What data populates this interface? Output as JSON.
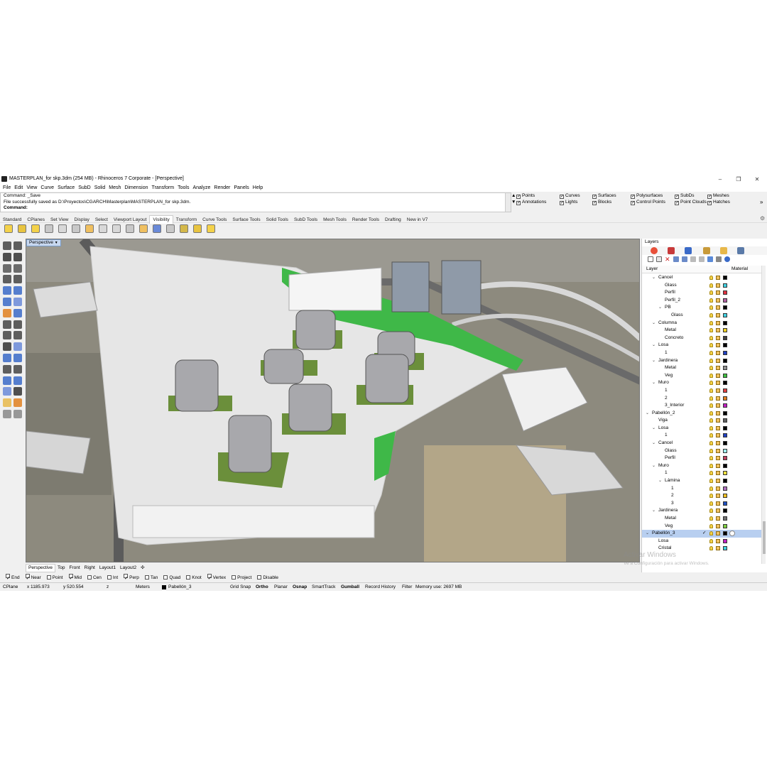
{
  "window": {
    "title": "MASTERPLAN_for skp.3dm (254 MB) - Rhinoceros 7 Corporate - [Perspective]",
    "minimize": "–",
    "maximize": "❐",
    "close": "✕"
  },
  "menu": [
    "File",
    "Edit",
    "View",
    "Curve",
    "Surface",
    "SubD",
    "Solid",
    "Mesh",
    "Dimension",
    "Transform",
    "Tools",
    "Analyze",
    "Render",
    "Panels",
    "Help"
  ],
  "command": {
    "line1": "Command: _Save",
    "line2": "File successfully saved as D:\\Proyectos\\CGARCH\\Masterplan\\MASTERPLAN_for skp.3dm.",
    "prompt": "Command:",
    "scroll_up": "▲",
    "scroll_down": "▼"
  },
  "selection_filters": [
    {
      "label": "Points",
      "checked": true
    },
    {
      "label": "Annotations",
      "checked": true
    },
    {
      "label": "Curves",
      "checked": true
    },
    {
      "label": "Lights",
      "checked": true
    },
    {
      "label": "Surfaces",
      "checked": true
    },
    {
      "label": "Blocks",
      "checked": true
    },
    {
      "label": "Polysurfaces",
      "checked": true
    },
    {
      "label": "Control Points",
      "checked": true
    },
    {
      "label": "SubDs",
      "checked": true
    },
    {
      "label": "Point Clouds",
      "checked": true
    },
    {
      "label": "Meshes",
      "checked": true
    },
    {
      "label": "Hatches",
      "checked": true
    }
  ],
  "filters_more": "»",
  "toolbar_tabs": [
    "Standard",
    "CPlanes",
    "Set View",
    "Display",
    "Select",
    "Viewport Layout",
    "Visibility",
    "Transform",
    "Curve Tools",
    "Surface Tools",
    "Solid Tools",
    "SubD Tools",
    "Mesh Tools",
    "Render Tools",
    "Drafting",
    "New in V7"
  ],
  "toolbar_active_tab": "Visibility",
  "toolbar_icons": [
    "show-icon",
    "hide-icon",
    "show-selected-icon",
    "swap-hidden-icon",
    "hide-swap-icon",
    "lock-icon",
    "unlock-icon",
    "lock-selected-icon",
    "unlock-selected-icon",
    "lock-swap-icon",
    "lock-icon",
    "isolate-icon",
    "unisolate-icon",
    "show-objects-icon",
    "hide-objects-icon",
    "show-layer-icon"
  ],
  "viewport": {
    "label": "Perspective",
    "dropdown": "▼",
    "tabs": [
      "Perspective",
      "Top",
      "Front",
      "Right",
      "Layout1",
      "Layout2"
    ],
    "add_tab": "✣",
    "active_tab": "Perspective"
  },
  "osnaps": [
    {
      "label": "End",
      "checked": true
    },
    {
      "label": "Near",
      "checked": true
    },
    {
      "label": "Point",
      "checked": false
    },
    {
      "label": "Mid",
      "checked": true
    },
    {
      "label": "Cen",
      "checked": false
    },
    {
      "label": "Int",
      "checked": false
    },
    {
      "label": "Perp",
      "checked": true
    },
    {
      "label": "Tan",
      "checked": false
    },
    {
      "label": "Quad",
      "checked": false
    },
    {
      "label": "Knot",
      "checked": false
    },
    {
      "label": "Vertex",
      "checked": true
    },
    {
      "label": "Project",
      "checked": false
    },
    {
      "label": "Disable",
      "checked": false
    }
  ],
  "status": {
    "cplane": "CPlane",
    "x": "x 1185.973",
    "y": "y 520.554",
    "z": "z",
    "units": "Meters",
    "layer": "Pabellón_3",
    "grid_snap": "Grid Snap",
    "ortho": "Ortho",
    "planar": "Planar",
    "osnap": "Osnap",
    "smarttrack": "SmartTrack",
    "gumball": "Gumball",
    "record_history": "Record History",
    "filter": "Filter",
    "memory": "Memory use: 2697 MB"
  },
  "layers_panel": {
    "title": "Layers",
    "col_layer": "Layer",
    "col_material": "Material",
    "rows": [
      {
        "name": "Cancel",
        "level": 1,
        "twisty": "v",
        "color": "#000000"
      },
      {
        "name": "Glass",
        "level": 2,
        "twisty": "",
        "color": "#40d0e0"
      },
      {
        "name": "Perfil",
        "level": 2,
        "twisty": "",
        "color": "#e03040"
      },
      {
        "name": "Perfil_2",
        "level": 2,
        "twisty": "",
        "color": "#b060a0"
      },
      {
        "name": "PB",
        "level": 2,
        "twisty": "v",
        "color": "#000000"
      },
      {
        "name": "Glass",
        "level": 3,
        "twisty": "",
        "color": "#40d0e0"
      },
      {
        "name": "Columna",
        "level": 1,
        "twisty": "v",
        "color": "#000000"
      },
      {
        "name": "Metal",
        "level": 2,
        "twisty": "",
        "color": "#f0d020"
      },
      {
        "name": "Concreto",
        "level": 2,
        "twisty": "",
        "color": "#404040"
      },
      {
        "name": "Losa",
        "level": 1,
        "twisty": "v",
        "color": "#000000"
      },
      {
        "name": "1",
        "level": 2,
        "twisty": "",
        "color": "#2040c0"
      },
      {
        "name": "Jardinera",
        "level": 1,
        "twisty": "v",
        "color": "#000000"
      },
      {
        "name": "Metal",
        "level": 2,
        "twisty": "",
        "color": "#909090"
      },
      {
        "name": "Veg",
        "level": 2,
        "twisty": "",
        "color": "#40c040"
      },
      {
        "name": "Muro",
        "level": 1,
        "twisty": "v",
        "color": "#000000"
      },
      {
        "name": "1",
        "level": 2,
        "twisty": "",
        "color": "#e04040"
      },
      {
        "name": "2",
        "level": 2,
        "twisty": "",
        "color": "#e08020"
      },
      {
        "name": "3_Interior",
        "level": 2,
        "twisty": "",
        "color": "#c020c0"
      },
      {
        "name": "Pabellón_2",
        "level": 0,
        "twisty": "v",
        "color": "#000000"
      },
      {
        "name": "Viga",
        "level": 1,
        "twisty": "",
        "color": "#606060"
      },
      {
        "name": "Losa",
        "level": 1,
        "twisty": "v",
        "color": "#000000"
      },
      {
        "name": "1",
        "level": 2,
        "twisty": "",
        "color": "#2040c0"
      },
      {
        "name": "Cancel",
        "level": 1,
        "twisty": "v",
        "color": "#000000"
      },
      {
        "name": "Glass",
        "level": 2,
        "twisty": "",
        "color": "#a0f0f0"
      },
      {
        "name": "Perfil",
        "level": 2,
        "twisty": "",
        "color": "#c04060"
      },
      {
        "name": "Muro",
        "level": 1,
        "twisty": "v",
        "color": "#000000"
      },
      {
        "name": "1",
        "level": 2,
        "twisty": "",
        "color": "#f0e040"
      },
      {
        "name": "Lámina",
        "level": 2,
        "twisty": "v",
        "color": "#000000"
      },
      {
        "name": "1",
        "level": 3,
        "twisty": "",
        "color": "#b070c0"
      },
      {
        "name": "2",
        "level": 3,
        "twisty": "",
        "color": "#f0c020"
      },
      {
        "name": "3",
        "level": 3,
        "twisty": "",
        "color": "#2050c0"
      },
      {
        "name": "Jardinera",
        "level": 1,
        "twisty": "v",
        "color": "#000000"
      },
      {
        "name": "Metal",
        "level": 2,
        "twisty": "",
        "color": "#707070"
      },
      {
        "name": "Veg",
        "level": 2,
        "twisty": "",
        "color": "#80d040"
      },
      {
        "name": "Pabellón_3",
        "level": 0,
        "twisty": "v",
        "color": "#000000",
        "selected": true,
        "current": "✓"
      },
      {
        "name": "Losa",
        "level": 1,
        "twisty": "",
        "color": "#c020c0"
      },
      {
        "name": "Cristal",
        "level": 1,
        "twisty": "",
        "color": "#40d0e0"
      }
    ]
  },
  "watermark": {
    "line1": "Activar Windows",
    "line2": "Ve a Configuración para activar Windows."
  }
}
